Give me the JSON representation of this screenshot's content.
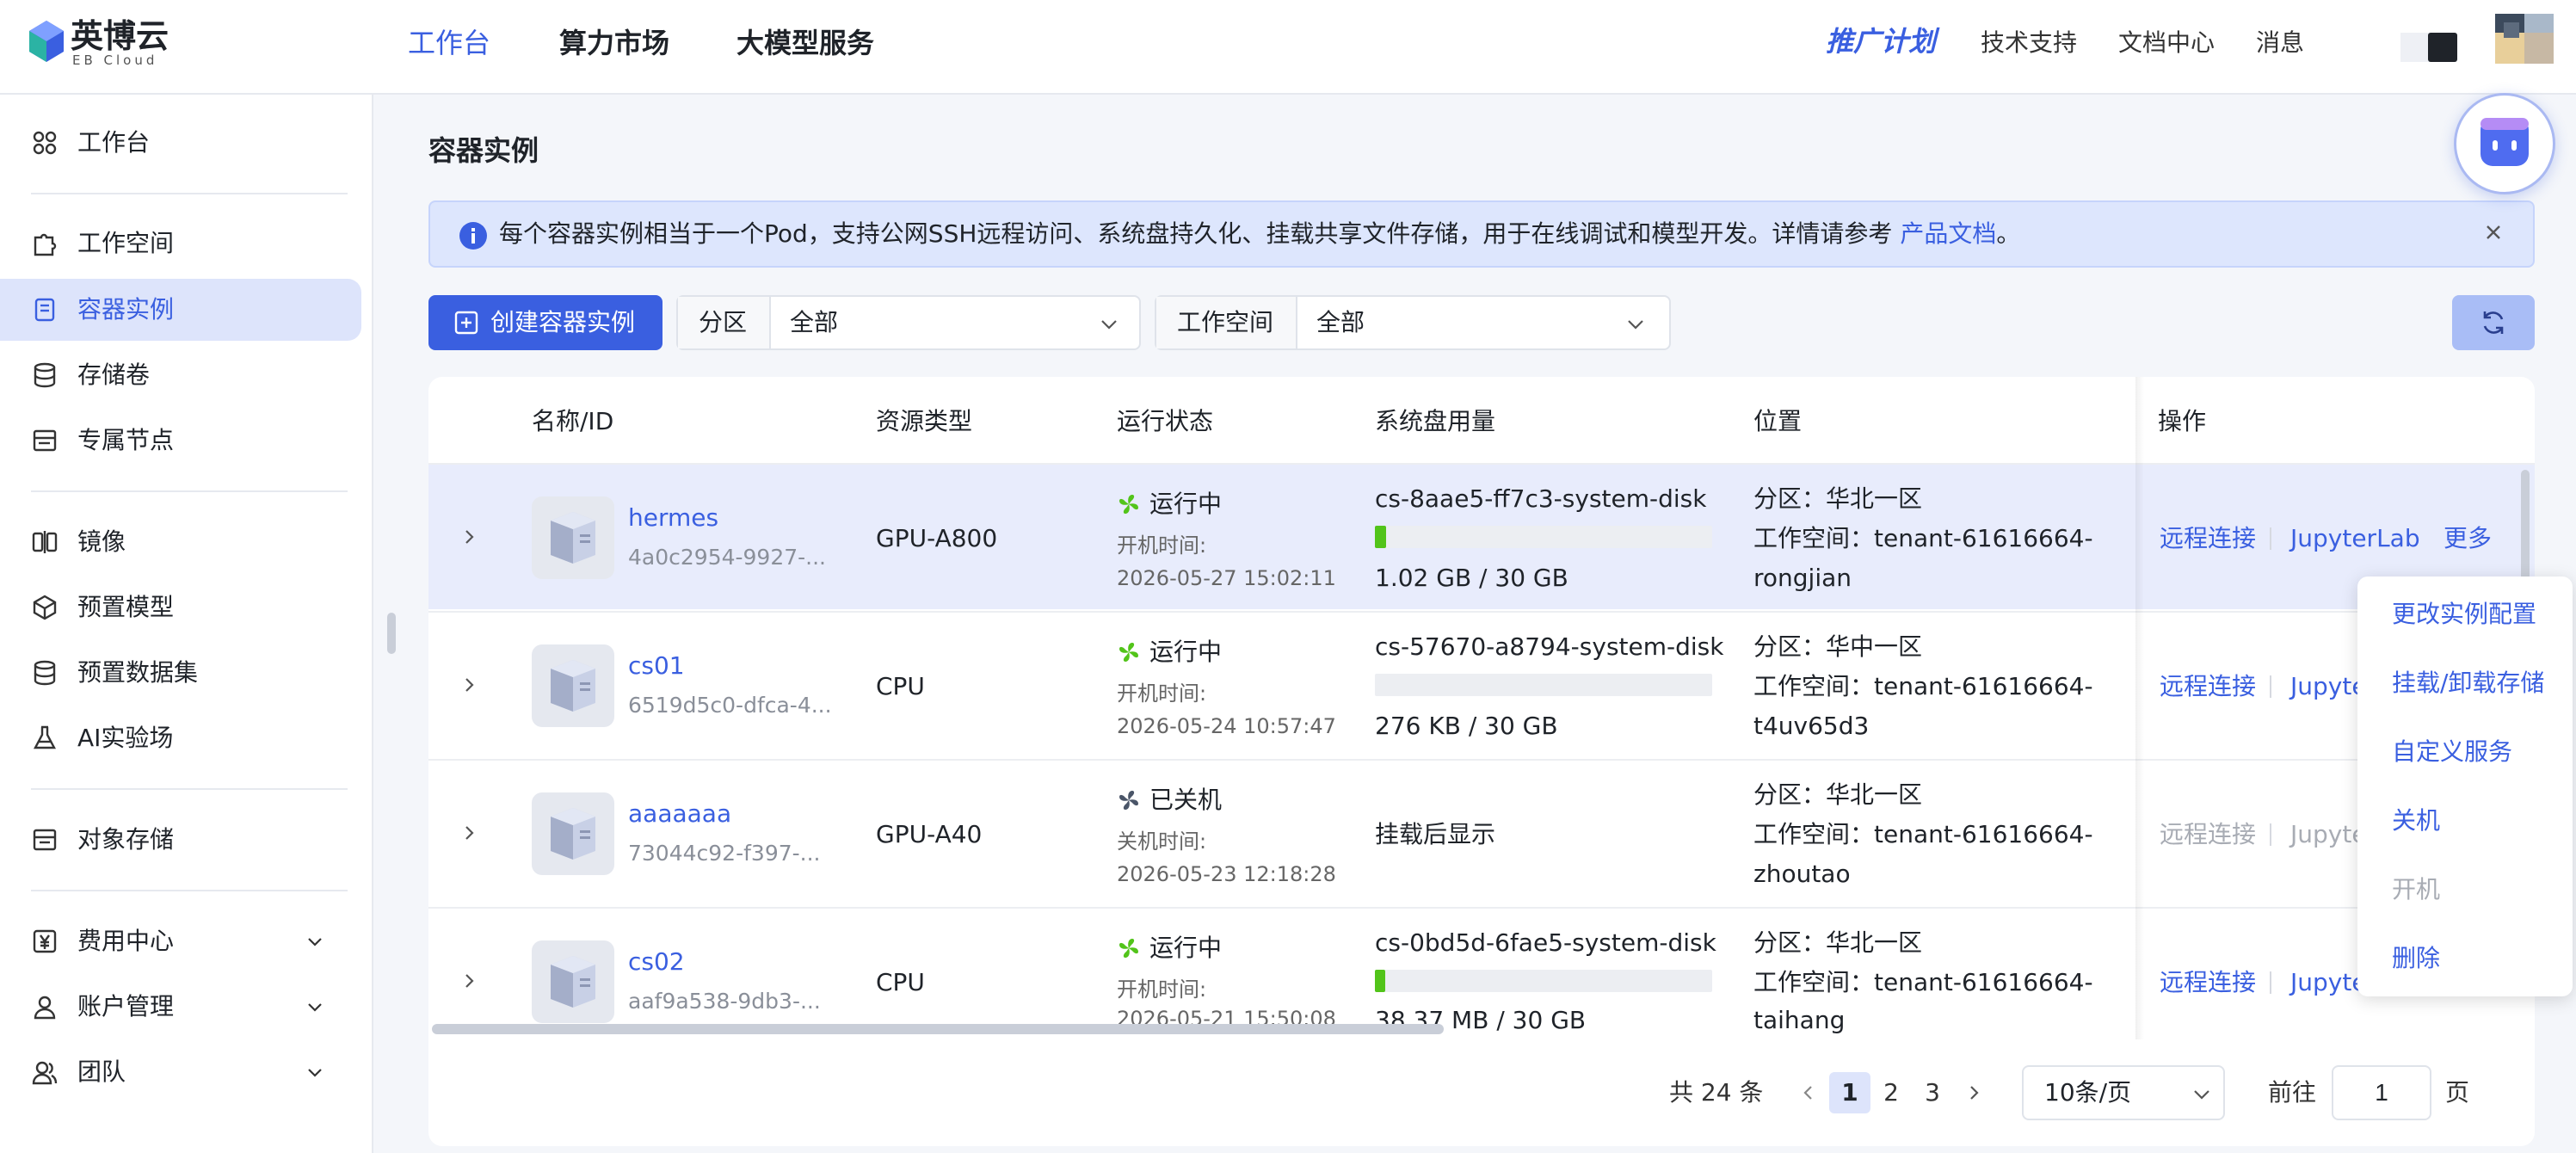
{
  "brand": {
    "name": "英博云",
    "sub": "EB Cloud"
  },
  "header": {
    "nav": [
      "工作台",
      "算力市场",
      "大模型服务"
    ],
    "promo": "推广计划",
    "links": [
      "技术支持",
      "文档中心",
      "消息"
    ]
  },
  "sidebar": {
    "items": [
      {
        "label": "工作台",
        "icon": "dashboard-icon"
      },
      {
        "label": "工作空间",
        "icon": "puzzle-icon"
      },
      {
        "label": "容器实例",
        "icon": "container-icon"
      },
      {
        "label": "存储卷",
        "icon": "database-icon"
      },
      {
        "label": "专属节点",
        "icon": "server-icon"
      },
      {
        "label": "镜像",
        "icon": "image-icon"
      },
      {
        "label": "预置模型",
        "icon": "cube-icon"
      },
      {
        "label": "预置数据集",
        "icon": "dataset-icon"
      },
      {
        "label": "AI实验场",
        "icon": "flask-icon"
      },
      {
        "label": "对象存储",
        "icon": "bucket-icon"
      },
      {
        "label": "费用中心",
        "icon": "yuan-icon"
      },
      {
        "label": "账户管理",
        "icon": "user-icon"
      },
      {
        "label": "团队",
        "icon": "team-icon"
      }
    ]
  },
  "page": {
    "title": "容器实例",
    "banner_text": "每个容器实例相当于一个Pod，支持公网SSH远程访问、系统盘持久化、挂载共享文件存储，用于在线调试和模型开发。详情请参考 ",
    "banner_link": "产品文档",
    "banner_end": "。",
    "create_button": "创建容器实例",
    "filters": [
      {
        "label": "分区",
        "value": "全部"
      },
      {
        "label": "工作空间",
        "value": "全部"
      }
    ]
  },
  "table": {
    "columns": [
      "名称/ID",
      "资源类型",
      "运行状态",
      "系统盘用量",
      "位置",
      "操作"
    ],
    "rows": [
      {
        "name": "hermes",
        "id": "4a0c2954-9927-...",
        "type": "GPU-A800",
        "status": "运行中",
        "time_label": "开机时间:",
        "time": "2026-05-27 15:02:11",
        "disk": "cs-8aae5-ff7c3-system-disk",
        "usage": "1.02 GB / 30 GB",
        "usage_fraction": 0.034,
        "zone": "分区：华北一区",
        "ws": "工作空间：tenant-61616664-",
        "ws2": "rongjian"
      },
      {
        "name": "cs01",
        "id": "6519d5c0-dfca-4...",
        "type": "CPU",
        "status": "运行中",
        "time_label": "开机时间:",
        "time": "2026-05-24 10:57:47",
        "disk": "cs-57670-a8794-system-disk",
        "usage": "276 KB / 30 GB",
        "usage_fraction": 0.0,
        "zone": "分区：华中一区",
        "ws": "工作空间：tenant-61616664-",
        "ws2": "t4uv65d3"
      },
      {
        "name": "aaaaaaa",
        "id": "73044c92-f397-...",
        "type": "GPU-A40",
        "status": "已关机",
        "time_label": "关机时间:",
        "time": "2026-05-23 12:18:28",
        "disk_note": "挂载后显示",
        "zone": "分区：华北一区",
        "ws": "工作空间：tenant-61616664-",
        "ws2": "zhoutao"
      },
      {
        "name": "cs02",
        "id": "aaf9a538-9db3-...",
        "type": "CPU",
        "status": "运行中",
        "time_label": "开机时间:",
        "time": "2026-05-21 15:50:08",
        "disk": "cs-0bd5d-6fae5-system-disk",
        "usage": "38.37 MB / 30 GB",
        "usage_fraction": 0.001,
        "zone": "分区：华北一区",
        "ws": "工作空间：tenant-61616664-",
        "ws2": "taihang"
      }
    ],
    "actions": {
      "remote": "远程连接",
      "jupyter": "JupyterLab",
      "jupyter_cut": "Jupyte",
      "more": "更多"
    }
  },
  "more_menu": [
    "更改实例配置",
    "挂载/卸载存储",
    "自定义服务",
    "关机",
    "开机",
    "删除"
  ],
  "pagination": {
    "total": "共 24 条",
    "pages": [
      "1",
      "2",
      "3"
    ],
    "page_size": "10条/页",
    "goto_label": "前往",
    "goto_value": "1",
    "goto_unit": "页"
  },
  "colors": {
    "primary": "#3a5fe0",
    "running": "#52c41a",
    "stopped": "#4a5568"
  }
}
